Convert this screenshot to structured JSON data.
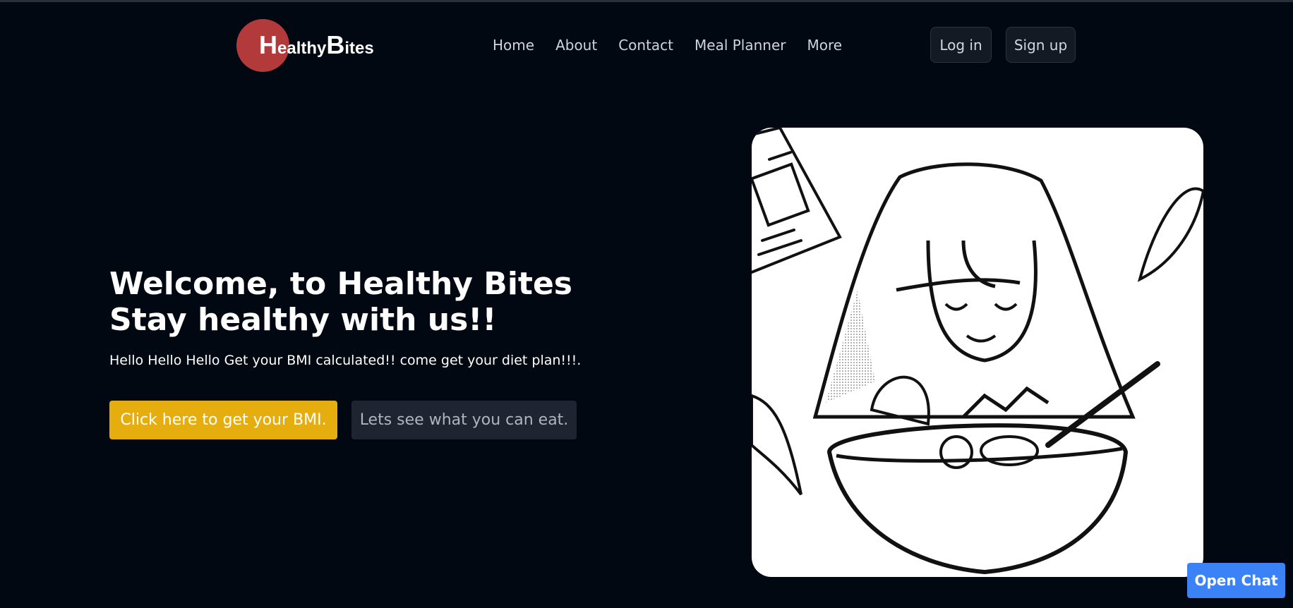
{
  "brand": {
    "letter1": "H",
    "rest1": "ealthy",
    "letter2": "B",
    "rest2": "ites",
    "circle_color": "#b23a3a"
  },
  "nav": {
    "items": [
      {
        "label": "Home"
      },
      {
        "label": "About"
      },
      {
        "label": "Contact"
      },
      {
        "label": "Meal Planner"
      },
      {
        "label": "More"
      }
    ]
  },
  "auth": {
    "login_label": "Log in",
    "signup_label": "Sign up"
  },
  "hero": {
    "title_line1": "Welcome, to Healthy Bites",
    "title_line2": "Stay healthy with us!!",
    "subtitle": "Hello Hello Hello Get your BMI calculated!! come get your diet plan!!!.",
    "primary_button": "Click here to get your BMI.",
    "secondary_button": "Lets see what you can eat.",
    "accent_color": "#e6ad0e"
  },
  "chat": {
    "button_label": "Open Chat",
    "color": "#3b82f6"
  }
}
